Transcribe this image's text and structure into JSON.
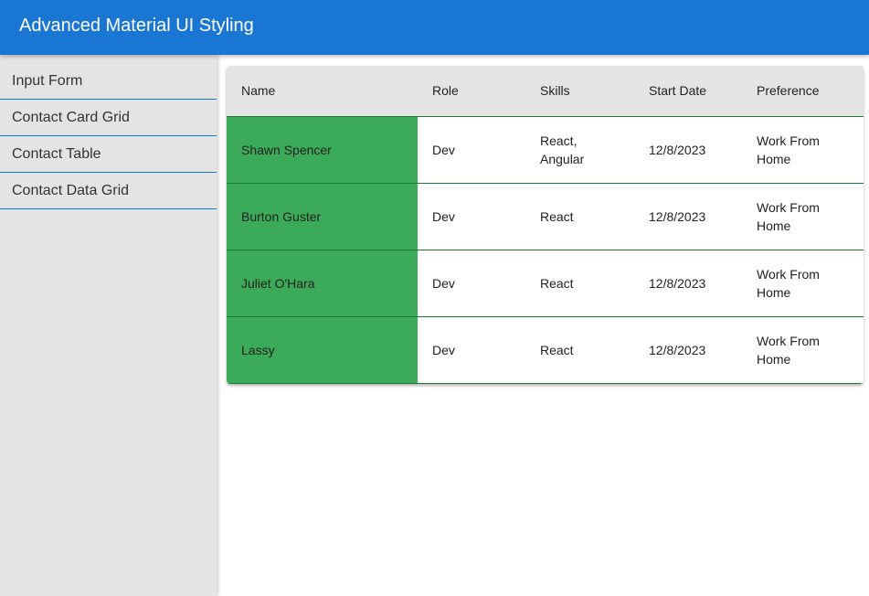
{
  "appbar": {
    "title": "Advanced Material UI Styling",
    "color": "#1976d2"
  },
  "sidebar": {
    "items": [
      {
        "label": "Input Form"
      },
      {
        "label": "Contact Card Grid"
      },
      {
        "label": "Contact Table"
      },
      {
        "label": "Contact Data Grid"
      }
    ]
  },
  "table": {
    "headers": [
      "Name",
      "Role",
      "Skills",
      "Start Date",
      "Preference"
    ],
    "name_cell_color": "#3bab5a",
    "rows": [
      {
        "name": "Shawn Spencer",
        "role": "Dev",
        "skills": "React, Angular",
        "start_date": "12/8/2023",
        "preference": "Work From Home"
      },
      {
        "name": "Burton Guster",
        "role": "Dev",
        "skills": "React",
        "start_date": "12/8/2023",
        "preference": "Work From Home"
      },
      {
        "name": "Juliet O'Hara",
        "role": "Dev",
        "skills": "React",
        "start_date": "12/8/2023",
        "preference": "Work From Home"
      },
      {
        "name": "Lassy",
        "role": "Dev",
        "skills": "React",
        "start_date": "12/8/2023",
        "preference": "Work From Home"
      }
    ]
  }
}
